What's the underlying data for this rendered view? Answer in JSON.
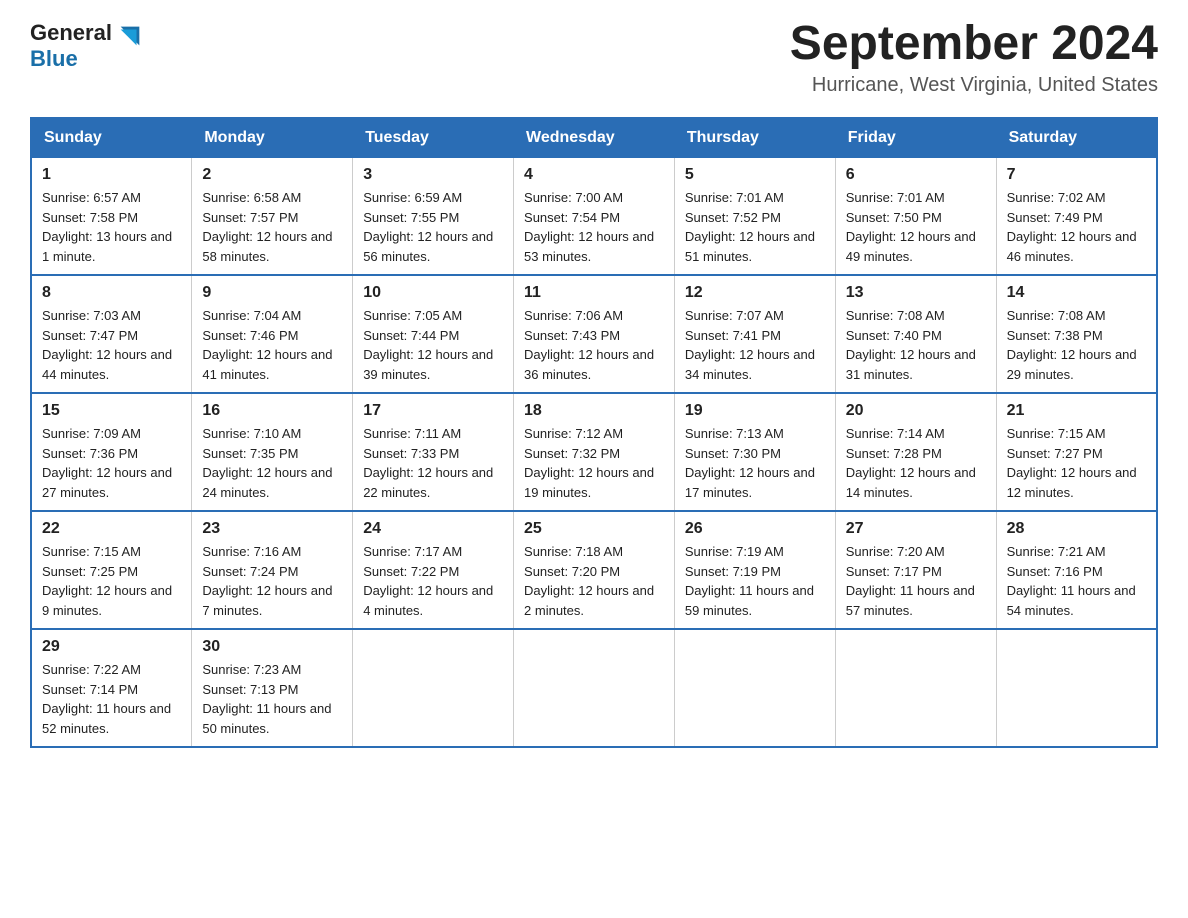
{
  "header": {
    "logo_general": "General",
    "logo_blue": "Blue",
    "month_title": "September 2024",
    "location": "Hurricane, West Virginia, United States"
  },
  "days_of_week": [
    "Sunday",
    "Monday",
    "Tuesday",
    "Wednesday",
    "Thursday",
    "Friday",
    "Saturday"
  ],
  "weeks": [
    [
      {
        "day": "1",
        "sunrise": "6:57 AM",
        "sunset": "7:58 PM",
        "daylight": "13 hours and 1 minute."
      },
      {
        "day": "2",
        "sunrise": "6:58 AM",
        "sunset": "7:57 PM",
        "daylight": "12 hours and 58 minutes."
      },
      {
        "day": "3",
        "sunrise": "6:59 AM",
        "sunset": "7:55 PM",
        "daylight": "12 hours and 56 minutes."
      },
      {
        "day": "4",
        "sunrise": "7:00 AM",
        "sunset": "7:54 PM",
        "daylight": "12 hours and 53 minutes."
      },
      {
        "day": "5",
        "sunrise": "7:01 AM",
        "sunset": "7:52 PM",
        "daylight": "12 hours and 51 minutes."
      },
      {
        "day": "6",
        "sunrise": "7:01 AM",
        "sunset": "7:50 PM",
        "daylight": "12 hours and 49 minutes."
      },
      {
        "day": "7",
        "sunrise": "7:02 AM",
        "sunset": "7:49 PM",
        "daylight": "12 hours and 46 minutes."
      }
    ],
    [
      {
        "day": "8",
        "sunrise": "7:03 AM",
        "sunset": "7:47 PM",
        "daylight": "12 hours and 44 minutes."
      },
      {
        "day": "9",
        "sunrise": "7:04 AM",
        "sunset": "7:46 PM",
        "daylight": "12 hours and 41 minutes."
      },
      {
        "day": "10",
        "sunrise": "7:05 AM",
        "sunset": "7:44 PM",
        "daylight": "12 hours and 39 minutes."
      },
      {
        "day": "11",
        "sunrise": "7:06 AM",
        "sunset": "7:43 PM",
        "daylight": "12 hours and 36 minutes."
      },
      {
        "day": "12",
        "sunrise": "7:07 AM",
        "sunset": "7:41 PM",
        "daylight": "12 hours and 34 minutes."
      },
      {
        "day": "13",
        "sunrise": "7:08 AM",
        "sunset": "7:40 PM",
        "daylight": "12 hours and 31 minutes."
      },
      {
        "day": "14",
        "sunrise": "7:08 AM",
        "sunset": "7:38 PM",
        "daylight": "12 hours and 29 minutes."
      }
    ],
    [
      {
        "day": "15",
        "sunrise": "7:09 AM",
        "sunset": "7:36 PM",
        "daylight": "12 hours and 27 minutes."
      },
      {
        "day": "16",
        "sunrise": "7:10 AM",
        "sunset": "7:35 PM",
        "daylight": "12 hours and 24 minutes."
      },
      {
        "day": "17",
        "sunrise": "7:11 AM",
        "sunset": "7:33 PM",
        "daylight": "12 hours and 22 minutes."
      },
      {
        "day": "18",
        "sunrise": "7:12 AM",
        "sunset": "7:32 PM",
        "daylight": "12 hours and 19 minutes."
      },
      {
        "day": "19",
        "sunrise": "7:13 AM",
        "sunset": "7:30 PM",
        "daylight": "12 hours and 17 minutes."
      },
      {
        "day": "20",
        "sunrise": "7:14 AM",
        "sunset": "7:28 PM",
        "daylight": "12 hours and 14 minutes."
      },
      {
        "day": "21",
        "sunrise": "7:15 AM",
        "sunset": "7:27 PM",
        "daylight": "12 hours and 12 minutes."
      }
    ],
    [
      {
        "day": "22",
        "sunrise": "7:15 AM",
        "sunset": "7:25 PM",
        "daylight": "12 hours and 9 minutes."
      },
      {
        "day": "23",
        "sunrise": "7:16 AM",
        "sunset": "7:24 PM",
        "daylight": "12 hours and 7 minutes."
      },
      {
        "day": "24",
        "sunrise": "7:17 AM",
        "sunset": "7:22 PM",
        "daylight": "12 hours and 4 minutes."
      },
      {
        "day": "25",
        "sunrise": "7:18 AM",
        "sunset": "7:20 PM",
        "daylight": "12 hours and 2 minutes."
      },
      {
        "day": "26",
        "sunrise": "7:19 AM",
        "sunset": "7:19 PM",
        "daylight": "11 hours and 59 minutes."
      },
      {
        "day": "27",
        "sunrise": "7:20 AM",
        "sunset": "7:17 PM",
        "daylight": "11 hours and 57 minutes."
      },
      {
        "day": "28",
        "sunrise": "7:21 AM",
        "sunset": "7:16 PM",
        "daylight": "11 hours and 54 minutes."
      }
    ],
    [
      {
        "day": "29",
        "sunrise": "7:22 AM",
        "sunset": "7:14 PM",
        "daylight": "11 hours and 52 minutes."
      },
      {
        "day": "30",
        "sunrise": "7:23 AM",
        "sunset": "7:13 PM",
        "daylight": "11 hours and 50 minutes."
      },
      null,
      null,
      null,
      null,
      null
    ]
  ]
}
